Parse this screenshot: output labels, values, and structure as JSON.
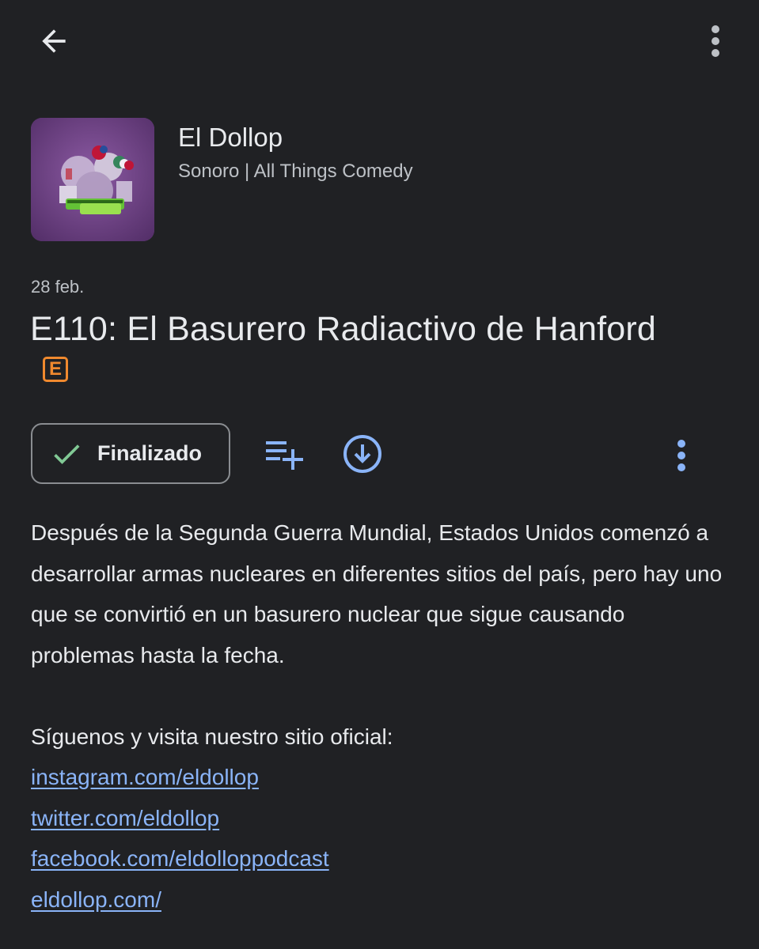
{
  "colors": {
    "background": "#202124",
    "text_primary": "#e8eaed",
    "text_secondary": "#bdc1c6",
    "accent_blue": "#8ab4f8",
    "check_green": "#81c995",
    "explicit_orange": "#f0892e"
  },
  "topbar": {
    "back_icon": "arrow-back-icon",
    "overflow_icon": "more-vert-icon"
  },
  "podcast": {
    "title": "El Dollop",
    "publisher": "Sonoro | All Things Comedy",
    "artwork_icon": "podcast-artwork"
  },
  "episode": {
    "date": "28 feb.",
    "title": "E110: El Basurero Radiactivo de Hanford",
    "explicit_badge": "E"
  },
  "actions": {
    "finalizado_label": "Finalizado",
    "check_icon": "check-icon",
    "queue_icon": "playlist-add-icon",
    "download_icon": "download-icon",
    "more_icon": "more-vert-icon"
  },
  "description": {
    "paragraph": "Después de la Segunda Guerra Mundial, Estados Unidos comenzó a desarrollar armas nucleares en diferentes sitios del país, pero hay uno que se convirtió en un basurero nuclear que sigue causando problemas hasta la fecha.",
    "follow_text": "Síguenos y visita nuestro sitio oficial:",
    "links": [
      "instagram.com/eldollop",
      "twitter.com/eldollop",
      "facebook.com/eldolloppodcast",
      "eldollop.com/"
    ]
  }
}
